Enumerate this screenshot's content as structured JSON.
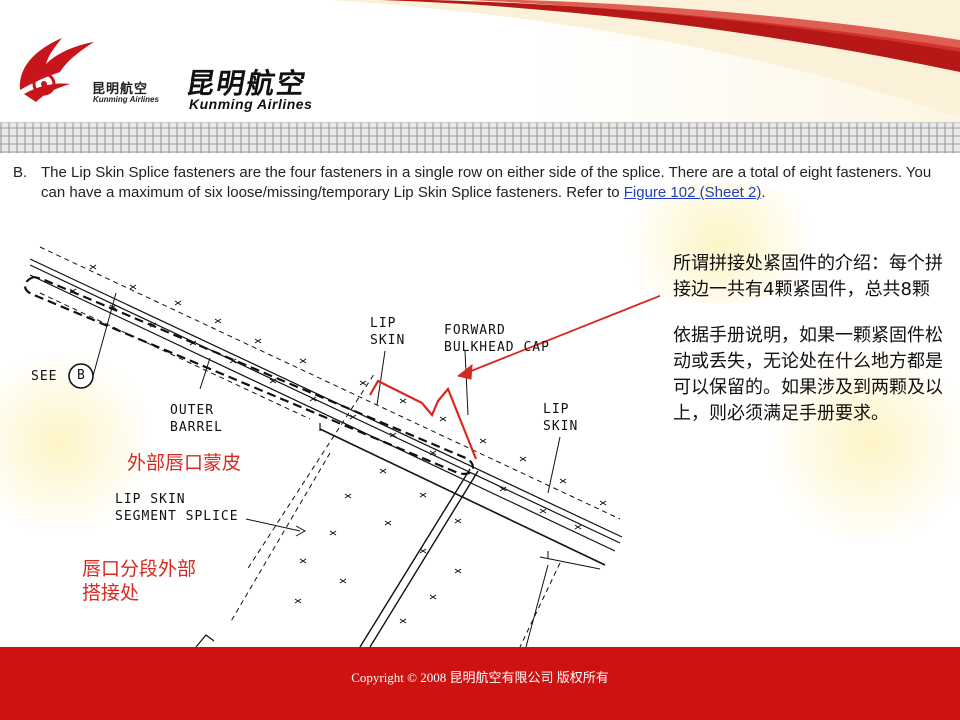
{
  "header": {
    "logo_small_cn": "昆明航空",
    "logo_small_en": "Kunming Airlines",
    "logo_big_cn": "昆明航空",
    "logo_big_en": "Kunming Airlines",
    "brand_color": "#cc1a1a"
  },
  "manual": {
    "item_label": "B.",
    "text_main": "The Lip Skin Splice fasteners are the four fasteners in a single row on either side of the splice. There are a total of eight fasteners. You can have a maximum of six loose/missing/temporary Lip Skin Splice fasteners. Refer to ",
    "link_text": "Figure 102 (Sheet 2)",
    "text_end": "."
  },
  "diagram": {
    "see_label": "SEE",
    "see_circle": "B",
    "outer_barrel": [
      "OUTER",
      "BARREL"
    ],
    "lip_skin_left": [
      "LIP",
      "SKIN"
    ],
    "forward_cap": [
      "FORWARD",
      "BULKHEAD CAP"
    ],
    "lip_skin_right": [
      "LIP",
      "SKIN"
    ],
    "segment_splice": [
      "LIP SKIN",
      "SEGMENT SPLICE"
    ]
  },
  "annotations": {
    "outer_lip_skin": "外部唇口蒙皮",
    "segment_outer_splice": [
      "唇口分段外部",
      "搭接处"
    ],
    "accent_color": "#d9281f"
  },
  "note": {
    "p1": "所谓拼接处紧固件的介绍：每个拼接边一共有4颗紧固件，总共8颗",
    "p2": "依据手册说明，如果一颗紧固件松动或丢失，无论处在什么地方都是可以保留的。如果涉及到两颗及以上，则必须满足手册要求。"
  },
  "footer": {
    "copyright": "Copyright  © 2008 昆明航空有限公司  版权所有",
    "color": "#cd1212"
  }
}
